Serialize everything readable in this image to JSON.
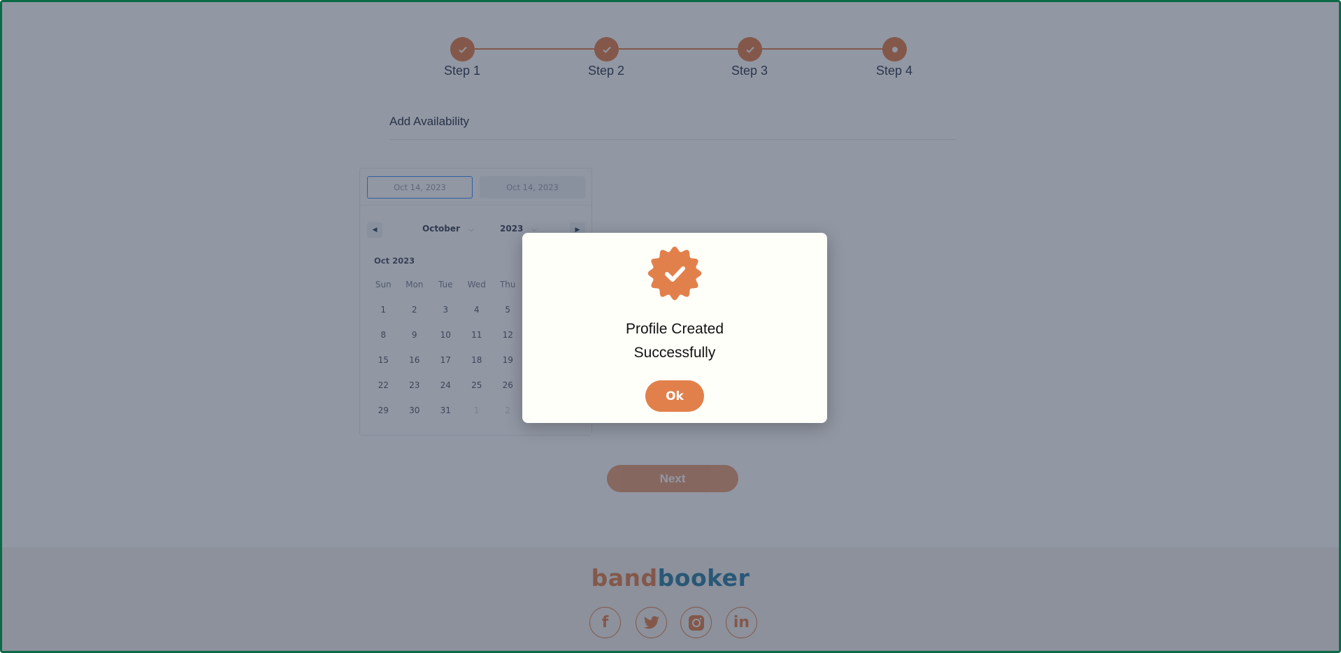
{
  "stepper": {
    "steps": [
      {
        "label": "Step 1",
        "state": "complete"
      },
      {
        "label": "Step 2",
        "state": "complete"
      },
      {
        "label": "Step 3",
        "state": "complete"
      },
      {
        "label": "Step 4",
        "state": "current"
      }
    ]
  },
  "section": {
    "title": "Add Availability"
  },
  "calendar": {
    "start_date": "Oct 14, 2023",
    "end_date": "Oct 14, 2023",
    "month": "October",
    "year": "2023",
    "caption": "Oct 2023",
    "weekdays": [
      "Sun",
      "Mon",
      "Tue",
      "Wed",
      "Thu"
    ],
    "days": [
      [
        "1",
        "2",
        "3",
        "4",
        "5"
      ],
      [
        "8",
        "9",
        "10",
        "11",
        "12"
      ],
      [
        "15",
        "16",
        "17",
        "18",
        "19"
      ],
      [
        "22",
        "23",
        "24",
        "25",
        "26"
      ],
      [
        "29",
        "30",
        "31",
        "1",
        "2"
      ]
    ]
  },
  "next_label": "Next",
  "footer": {
    "logo_part1": "band",
    "logo_part2": "booker",
    "social": [
      "facebook",
      "twitter",
      "instagram",
      "linkedin"
    ]
  },
  "modal": {
    "line1": "Profile Created",
    "line2": "Successfully",
    "ok_label": "Ok",
    "icon": "verified-badge-check"
  },
  "colors": {
    "accent": "#e2804c",
    "brand_blue": "#2f7ea5",
    "frame": "#0b6a46"
  }
}
